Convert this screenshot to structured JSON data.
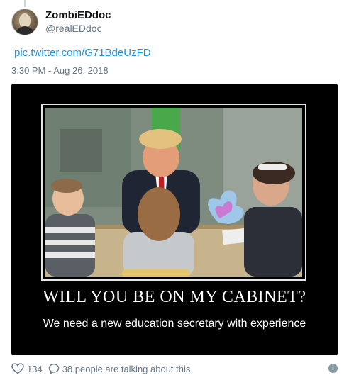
{
  "tweet": {
    "display_name": "ZombiEDdoc",
    "handle": "@realEDdoc",
    "link_text": "pic.twitter.com/G71BdeUzFD",
    "timestamp": "3:30 PM - Aug 26, 2018"
  },
  "media": {
    "caption_title": "WILL YOU BE ON MY CABINET?",
    "caption_subtitle": "We need a new education secretary with experience"
  },
  "footer": {
    "like_count": "134",
    "talking_text": "38 people are talking about this",
    "like_icon": "heart-icon",
    "reply_icon": "speech-bubble-icon",
    "info_icon": "info-icon",
    "accent_color": "#1b95e0"
  }
}
